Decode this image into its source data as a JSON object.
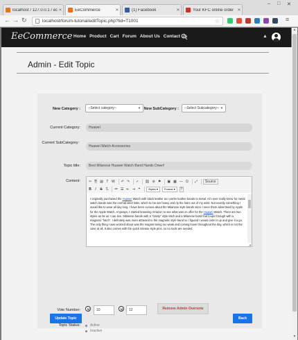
{
  "browser": {
    "tabs": [
      {
        "title": "localhost / 127.0.0.1 / ec",
        "fav_color": "#e07b1c"
      },
      {
        "title": "EeCommerce",
        "fav_color": "#e8711a"
      },
      {
        "title": "(1) Facebook",
        "fav_color": "#3b5998"
      },
      {
        "title": "Your KFC online order",
        "fav_color": "#c0392b"
      }
    ],
    "url": "localhost/forum-tutorial/editTopic.php?tid=T1001"
  },
  "header": {
    "logo": "EeCommerce",
    "nav": [
      "Home",
      "Product",
      "Cart",
      "Forum",
      "About Us",
      "Contact Us"
    ]
  },
  "page": {
    "title": "Admin - Edit Topic"
  },
  "form": {
    "new_category_label": "New Category :",
    "new_category_value": "--Select category--",
    "new_subcategory_label": "New SubCategory :",
    "new_subcategory_value": "--Select Subcategory--",
    "current_category_label": "Current Category:",
    "current_category_value": "Huawei",
    "current_subcategory_label": "Current SubCategory:",
    "current_subcategory_value": "Huawei Watch Accessories",
    "topic_title_label": "Topic title:",
    "topic_title_value": "Best Milanese Huawei Watch Band Hands Down!",
    "content_label": "Content:",
    "editor": {
      "source_label": "Source",
      "styles_label": "Styles",
      "format_label": "Format",
      "content_before_link": "I originally purchased the ",
      "content_link_1": "Huawei",
      "content_mid_1": " Watch with black leather as I prefer leather bands to metal. All I ever really knew for metal watch bands was the normal steel links, which to me are heavy and rip the hairs out of my wrist. Not exactly something I would like to wear all day long. I have been curious about the Milanese style bands since I seen them advertised by Apple for the Apple Watch. Anyways, I started browsing Amazon to see what was on offer for the ",
      "content_link_2": "Huawei",
      "content_after": " Watch. There are two styles as far as I can see, Milanese bands with a \"clamp\" style latch and a Milanese band that loops through with a magnetic \"latch\". I definitely was more attracted to the magnetic style band so I figured I would order it up and give it a go. The only thing I was worried about was the magnet being too weak and coming loose throughout the day, which is not the case at all. It also comes with the quick release style pins, so no tools are needed."
    },
    "vote_label": "Vote Number:",
    "vote_up": "10",
    "vote_down": "12",
    "remove_overvote": "Remove Admin Overvote",
    "status_label": "Topic Status:",
    "status_active": "Active",
    "status_inactive": "Inactive",
    "update_button": "Update Topic",
    "back_button": "Back"
  }
}
